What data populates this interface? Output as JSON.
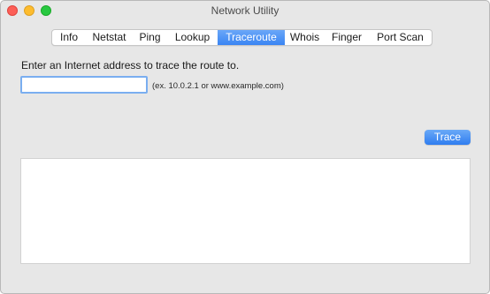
{
  "window": {
    "title": "Network Utility",
    "controls": [
      "close",
      "minimize",
      "zoom"
    ]
  },
  "tabs": [
    {
      "label": "Info",
      "active": false
    },
    {
      "label": "Netstat",
      "active": false
    },
    {
      "label": "Ping",
      "active": false
    },
    {
      "label": "Lookup",
      "active": false
    },
    {
      "label": "Traceroute",
      "active": true
    },
    {
      "label": "Whois",
      "active": false
    },
    {
      "label": "Finger",
      "active": false
    },
    {
      "label": "Port Scan",
      "active": false
    }
  ],
  "traceroute": {
    "prompt": "Enter an Internet address to trace the route to.",
    "address_value": "",
    "address_hint": "(ex. 10.0.2.1 or www.example.com)",
    "trace_label": "Trace",
    "output_text": ""
  },
  "colors": {
    "accent": "#3a85f3",
    "close": "#fc5f57",
    "minimize": "#fdbc2e",
    "zoom": "#28c840"
  }
}
